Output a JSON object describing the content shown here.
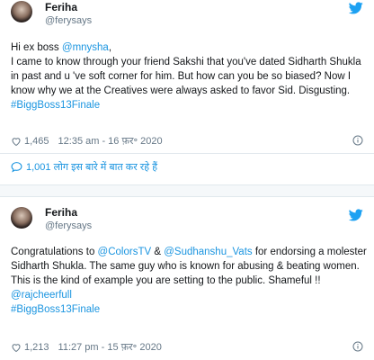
{
  "tweets": [
    {
      "name": "Feriha",
      "handle": "@ferysays",
      "body": {
        "p1": "Hi ex boss ",
        "m1": "@mnysha",
        "p2": ",",
        "p3": "I came to know through your friend Sakshi that you've dated Sidharth Shukla in past and u 've soft corner for him. But how can you be so biased? Now I know why we at the Creatives were always asked to favor Sid. Disgusting. ",
        "h1": "#BiggBoss13Finale"
      },
      "likes": "1,465",
      "timestamp": "12:35 am - 16 फ़र॰ 2020",
      "replies_text": "1,001 लोग इस बारे में बात कर रहे हैं"
    },
    {
      "name": "Feriha",
      "handle": "@ferysays",
      "body": {
        "p1": "Congratulations to ",
        "m1": "@ColorsTV",
        "p2": " & ",
        "m2": "@Sudhanshu_Vats",
        "p3": " for endorsing a molester Sidharth Shukla. The same guy who is known for abusing & beating women. This is the kind of example you are setting to the public. Shameful !! ",
        "m3": "@rajcheerfull",
        "h1": "#BiggBoss13Finale"
      },
      "likes": "1,213",
      "timestamp": "11:27 pm - 15 फ़र॰ 2020"
    }
  ],
  "icons": {
    "bird": "twitter-bird-icon",
    "heart": "heart-icon",
    "info": "info-icon",
    "reply": "reply-bubble-icon"
  },
  "colors": {
    "link": "#1b95e0",
    "muted": "#657786",
    "text": "#14171a"
  }
}
